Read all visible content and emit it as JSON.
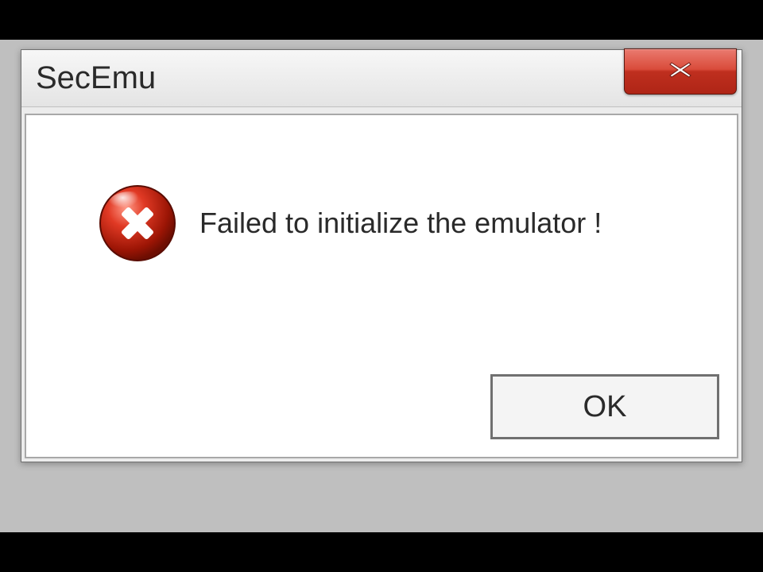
{
  "dialog": {
    "title": "SecEmu",
    "message": "Failed to initialize the emulator !",
    "ok_label": "OK",
    "icon_name": "error-icon",
    "close_icon_name": "close-icon"
  }
}
